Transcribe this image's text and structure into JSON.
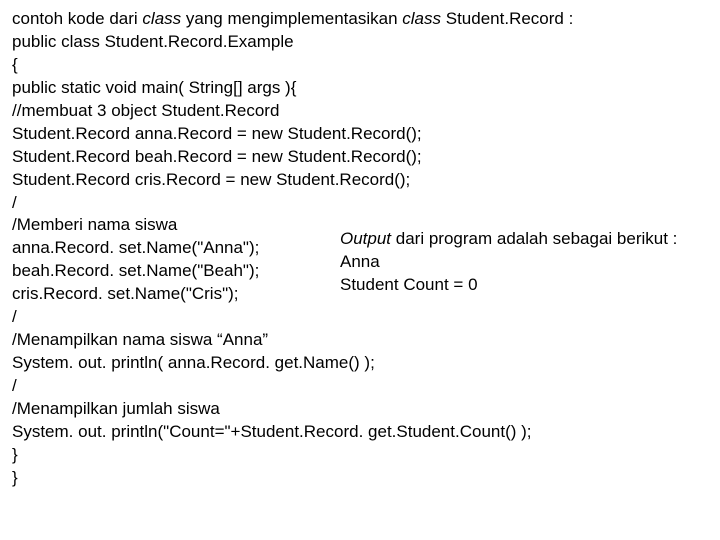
{
  "lines": {
    "l0_pre": "contoh kode dari ",
    "l0_it1": "class",
    "l0_mid": " yang mengimplementasikan ",
    "l0_it2": "class",
    "l0_post": " Student.Record :",
    "l1": "public class Student.Record.Example",
    "l2": "{",
    "l3": "public static void main( String[] args ){",
    "l4": "//membuat 3 object Student.Record",
    "l5": "Student.Record anna.Record = new Student.Record();",
    "l6": "Student.Record beah.Record = new Student.Record();",
    "l7": "Student.Record cris.Record = new Student.Record();",
    "l8": "/",
    "l9": "/Memberi nama siswa",
    "l10": "anna.Record. set.Name(\"Anna\");",
    "l11": "beah.Record. set.Name(\"Beah\");",
    "l12": "cris.Record. set.Name(\"Cris\");",
    "l13": "/",
    "l14": "/Menampilkan nama siswa “Anna”",
    "l15": "System. out. println( anna.Record. get.Name() );",
    "l16": "/",
    "l17": "/Menampilkan jumlah siswa",
    "l18": "System. out. println(\"Count=\"+Student.Record. get.Student.Count() );",
    "l19": "}",
    "l20": "}"
  },
  "output": {
    "o0_it": "Output",
    "o0_post": " dari program adalah sebagai berikut :",
    "o1": "Anna",
    "o2": "Student Count = 0"
  }
}
